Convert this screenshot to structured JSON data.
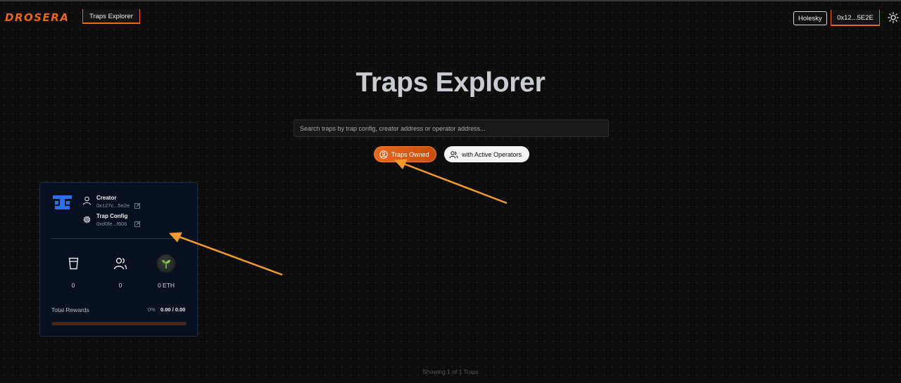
{
  "header": {
    "logo": "DROSERA",
    "nav_tab": "Traps Explorer",
    "network": "Holesky",
    "wallet": "0x12...5E2E",
    "theme_icon": "sun-icon"
  },
  "main": {
    "title": "Traps Explorer",
    "search_placeholder": "Search traps by trap config, creator address or operator address...",
    "filters": [
      {
        "label": "Traps Owned",
        "icon": "user-circle-icon",
        "active": true
      },
      {
        "label": "with Active Operators",
        "icon": "users-icon",
        "active": false
      }
    ]
  },
  "card": {
    "creator_label": "Creator",
    "creator_value": "0x127c...5e2e",
    "config_label": "Trap Config",
    "config_value": "0xd0fe...f606",
    "stats": [
      {
        "icon": "cup-icon",
        "value": "0"
      },
      {
        "icon": "users-icon",
        "value": "0"
      },
      {
        "icon": "sprout-icon",
        "value": "0 ETH"
      }
    ],
    "rewards_label": "Total Rewards",
    "rewards_percent": "0%",
    "rewards_amount": "0.00 / 0.00",
    "rewards_progress": 0
  },
  "footer": {
    "showing": "Showing 1 of 1 Traps"
  },
  "colors": {
    "accent": "#e8651c",
    "card_bg": "#08101f",
    "arrow": "#f29a2e"
  }
}
